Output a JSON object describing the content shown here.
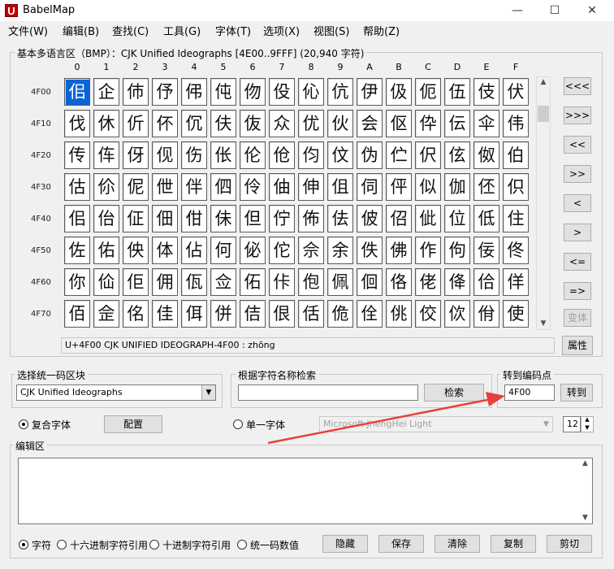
{
  "window": {
    "title": "BabelMap",
    "icon_letter": "U",
    "minimize": "—",
    "maximize": "☐",
    "close": "✕"
  },
  "menu": [
    "文件(W)",
    "编辑(B)",
    "查找(C)",
    "工具(G)",
    "字体(T)",
    "选项(X)",
    "视图(S)",
    "帮助(Z)"
  ],
  "block_panel": {
    "title": "基本多语言区（BMP）：CJK Unified Ideographs [4E00..9FFF] (20,940 字符)",
    "col_headers": [
      "0",
      "1",
      "2",
      "3",
      "4",
      "5",
      "6",
      "7",
      "8",
      "9",
      "A",
      "B",
      "C",
      "D",
      "E",
      "F"
    ],
    "rows": [
      {
        "label": "4F00",
        "chars": [
          "佀",
          "企",
          "伂",
          "伃",
          "伄",
          "伅",
          "伆",
          "伇",
          "伈",
          "伉",
          "伊",
          "伋",
          "伌",
          "伍",
          "伎",
          "伏"
        ]
      },
      {
        "label": "4F10",
        "chars": [
          "伐",
          "休",
          "伒",
          "伓",
          "伔",
          "伕",
          "伖",
          "众",
          "优",
          "伙",
          "会",
          "伛",
          "伜",
          "伝",
          "伞",
          "伟"
        ]
      },
      {
        "label": "4F20",
        "chars": [
          "传",
          "伡",
          "伢",
          "伣",
          "伤",
          "伥",
          "伦",
          "伧",
          "伨",
          "伩",
          "伪",
          "伫",
          "伬",
          "伭",
          "伮",
          "伯"
        ]
      },
      {
        "label": "4F30",
        "chars": [
          "估",
          "伱",
          "伲",
          "伳",
          "伴",
          "伵",
          "伶",
          "伷",
          "伸",
          "伹",
          "伺",
          "伻",
          "似",
          "伽",
          "伾",
          "伿"
        ]
      },
      {
        "label": "4F40",
        "chars": [
          "佀",
          "佁",
          "佂",
          "佃",
          "佄",
          "佅",
          "但",
          "佇",
          "佈",
          "佉",
          "佊",
          "佋",
          "佌",
          "位",
          "低",
          "住"
        ]
      },
      {
        "label": "4F50",
        "chars": [
          "佐",
          "佑",
          "佒",
          "体",
          "佔",
          "何",
          "佖",
          "佗",
          "佘",
          "余",
          "佚",
          "佛",
          "作",
          "佝",
          "佞",
          "佟"
        ]
      },
      {
        "label": "4F60",
        "chars": [
          "你",
          "佡",
          "佢",
          "佣",
          "佤",
          "佥",
          "佦",
          "佧",
          "佨",
          "佩",
          "佪",
          "佫",
          "佬",
          "佭",
          "佮",
          "佯"
        ]
      },
      {
        "label": "4F70",
        "chars": [
          "佰",
          "佱",
          "佲",
          "佳",
          "佴",
          "併",
          "佶",
          "佷",
          "佸",
          "佹",
          "佺",
          "佻",
          "佼",
          "佽",
          "佾",
          "使"
        ]
      }
    ],
    "nav_buttons": [
      "<<<",
      ">>>",
      "<<",
      ">>",
      "<",
      ">",
      "<=",
      "=>"
    ],
    "font_button": "变体",
    "status": "U+4F00 CJK UNIFIED IDEOGRAPH-4F00 : zhōng",
    "properties_button": "属性"
  },
  "unicode_block": {
    "title": "选择统一码区块",
    "value": "CJK Unified Ideographs"
  },
  "name_search": {
    "title": "根据字符名称检索",
    "value": "",
    "button": "检索"
  },
  "goto": {
    "title": "转到编码点",
    "value": "4F00",
    "button": "转到"
  },
  "font_options": {
    "composite_label": "复合字体",
    "config_button": "配置",
    "single_label": "单一字体",
    "font_name": "Microsoft JhengHei Light",
    "font_size": "12"
  },
  "edit_area": {
    "title": "编辑区",
    "radios": [
      "字符",
      "十六进制字符引用",
      "十进制字符引用",
      "统一码数值"
    ],
    "buttons": [
      "隐藏",
      "保存",
      "清除",
      "复制",
      "剪切"
    ]
  },
  "colors": {
    "selection": "#0a64d6",
    "arrow": "#e8403a"
  }
}
